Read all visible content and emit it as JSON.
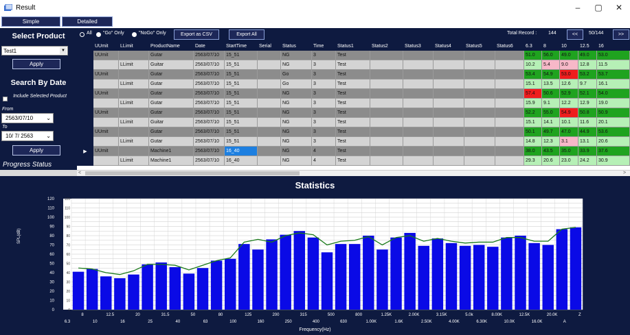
{
  "window": {
    "title": "Result",
    "controls": [
      "–",
      "▢",
      "✕"
    ]
  },
  "tabs": [
    "Simple",
    "Detailed"
  ],
  "sidebar": {
    "select_product_heading": "Select Product",
    "product_value": "Test1",
    "apply_label": "Apply",
    "search_heading": "Search By Date",
    "include_selected_label": "Include Selected Product",
    "from_label": "From",
    "from_value": "2563/07/10",
    "to_label": "To",
    "to_value": "10/ 7/ 2563",
    "apply2_label": "Apply",
    "progress_label": "Progress Status"
  },
  "toolbar": {
    "filter_options": [
      "All",
      "\"Go\" Only",
      "\"NoGo\" Only"
    ],
    "export_csv_label": "Export as CSV",
    "export_all_label": "Export All",
    "total_record_label": "Total Record :",
    "total_record_value": "144",
    "prev_label": "<<",
    "page_label": "50/144",
    "next_label": ">>"
  },
  "table": {
    "columns": [
      "UUmit",
      "LLimit",
      "ProductName",
      "Date",
      "StartTime",
      "Serial",
      "Status",
      "Time",
      "Status1",
      "Status2",
      "Status3",
      "Status4",
      "Status5",
      "Status6",
      "6.3",
      "8",
      "10",
      "12.5",
      "16"
    ],
    "rows": [
      {
        "type": "U",
        "u": "UUmit",
        "l": "",
        "name": "Gutar",
        "date": "2563/07/10",
        "start": "15_51",
        "status": "NG",
        "time": "3",
        "s1": "Test",
        "freq": [
          {
            "v": "51.0",
            "c": "green"
          },
          {
            "v": "56.0",
            "c": "green"
          },
          {
            "v": "49.0",
            "c": "green"
          },
          {
            "v": "49.0",
            "c": "green"
          },
          {
            "v": "53.0",
            "c": "green"
          }
        ]
      },
      {
        "type": "L",
        "u": "",
        "l": "LLimit",
        "name": "Guitar",
        "date": "2563/07/10",
        "start": "15_51",
        "status": "NG",
        "time": "3",
        "s1": "Test",
        "freq": [
          {
            "v": "10.2",
            "c": "lgreen"
          },
          {
            "v": "5.4",
            "c": "pink"
          },
          {
            "v": "9.0",
            "c": "pink"
          },
          {
            "v": "12.8",
            "c": "lgreen"
          },
          {
            "v": "11.5",
            "c": "lgreen"
          }
        ]
      },
      {
        "type": "U",
        "u": "UUmit",
        "l": "",
        "name": "Gutar",
        "date": "2563/07/10",
        "start": "15_51",
        "status": "Go",
        "time": "3",
        "s1": "Test",
        "freq": [
          {
            "v": "53.4",
            "c": "green"
          },
          {
            "v": "54.9",
            "c": "green"
          },
          {
            "v": "53.0",
            "c": "red"
          },
          {
            "v": "53.2",
            "c": "green"
          },
          {
            "v": "53.7",
            "c": "green"
          }
        ]
      },
      {
        "type": "L",
        "u": "",
        "l": "LLimit",
        "name": "Gutar",
        "date": "2563/07/10",
        "start": "15_51",
        "status": "Go",
        "time": "3",
        "s1": "Test",
        "freq": [
          {
            "v": "15.1",
            "c": "lgreen"
          },
          {
            "v": "13.5",
            "c": "lgreen"
          },
          {
            "v": "12.6",
            "c": "lgreen"
          },
          {
            "v": "9.7",
            "c": "lgreen"
          },
          {
            "v": "16.1",
            "c": "lgreen"
          }
        ]
      },
      {
        "type": "U",
        "u": "UUmit",
        "l": "",
        "name": "Gutar",
        "date": "2563/07/10",
        "start": "15_51",
        "status": "NG",
        "time": "3",
        "s1": "Test",
        "freq": [
          {
            "v": "57.4",
            "c": "red"
          },
          {
            "v": "50.6",
            "c": "green"
          },
          {
            "v": "52.9",
            "c": "green"
          },
          {
            "v": "52.1",
            "c": "green"
          },
          {
            "v": "54.0",
            "c": "green"
          }
        ]
      },
      {
        "type": "L",
        "u": "",
        "l": "LLimit",
        "name": "Gutar",
        "date": "2563/07/10",
        "start": "15_51",
        "status": "NG",
        "time": "3",
        "s1": "Test",
        "freq": [
          {
            "v": "15.9",
            "c": "lgreen"
          },
          {
            "v": "9.1",
            "c": "lgreen"
          },
          {
            "v": "12.2",
            "c": "lgreen"
          },
          {
            "v": "12.9",
            "c": "lgreen"
          },
          {
            "v": "19.0",
            "c": "lgreen"
          }
        ]
      },
      {
        "type": "U",
        "u": "UUmit",
        "l": "",
        "name": "Gutar",
        "date": "2563/07/10",
        "start": "15_51",
        "status": "NG",
        "time": "3",
        "s1": "Test",
        "freq": [
          {
            "v": "52.2",
            "c": "green"
          },
          {
            "v": "55.0",
            "c": "green"
          },
          {
            "v": "54.9",
            "c": "red"
          },
          {
            "v": "50.8",
            "c": "green"
          },
          {
            "v": "50.9",
            "c": "green"
          }
        ]
      },
      {
        "type": "L",
        "u": "",
        "l": "LLimit",
        "name": "Guitar",
        "date": "2563/07/10",
        "start": "15_51",
        "status": "NG",
        "time": "3",
        "s1": "Test",
        "freq": [
          {
            "v": "15.1",
            "c": "lgreen"
          },
          {
            "v": "14.1",
            "c": "lgreen"
          },
          {
            "v": "10.1",
            "c": "lgreen"
          },
          {
            "v": "11.6",
            "c": "lgreen"
          },
          {
            "v": "20.1",
            "c": "lgreen"
          }
        ]
      },
      {
        "type": "U",
        "u": "UUmit",
        "l": "",
        "name": "Gutar",
        "date": "2563/07/10",
        "start": "15_51",
        "status": "NG",
        "time": "3",
        "s1": "Test",
        "freq": [
          {
            "v": "50.1",
            "c": "green"
          },
          {
            "v": "49.7",
            "c": "green"
          },
          {
            "v": "47.0",
            "c": "green"
          },
          {
            "v": "44.9",
            "c": "green"
          },
          {
            "v": "53.6",
            "c": "green"
          }
        ]
      },
      {
        "type": "L",
        "u": "",
        "l": "LLimit",
        "name": "Gutar",
        "date": "2563/07/10",
        "start": "15_51",
        "status": "NG",
        "time": "3",
        "s1": "Test",
        "freq": [
          {
            "v": "14.8",
            "c": "lgreen"
          },
          {
            "v": "12.3",
            "c": "lgreen"
          },
          {
            "v": "3.1",
            "c": "pink"
          },
          {
            "v": "13.1",
            "c": "lgreen"
          },
          {
            "v": "20.6",
            "c": "lgreen"
          }
        ]
      },
      {
        "type": "U",
        "u": "UUmit",
        "l": "",
        "name": "Machine1",
        "date": "2563/07/10",
        "start": "16_40",
        "status": "NG",
        "time": "4",
        "s1": "Test",
        "selected": true,
        "freq": [
          {
            "v": "38.0",
            "c": "green"
          },
          {
            "v": "43.5",
            "c": "green"
          },
          {
            "v": "35.0",
            "c": "green"
          },
          {
            "v": "33.9",
            "c": "green"
          },
          {
            "v": "37.6",
            "c": "green"
          }
        ]
      },
      {
        "type": "L",
        "u": "",
        "l": "LLimit",
        "name": "Machine1",
        "date": "2563/07/10",
        "start": "16_40",
        "status": "NG",
        "time": "4",
        "s1": "Test",
        "freq": [
          {
            "v": "29.3",
            "c": "lgreen"
          },
          {
            "v": "20.6",
            "c": "lgreen"
          },
          {
            "v": "23.0",
            "c": "lgreen"
          },
          {
            "v": "24.2",
            "c": "lgreen"
          },
          {
            "v": "30.9",
            "c": "lgreen"
          }
        ]
      }
    ]
  },
  "colors": {
    "navy": "#0e1a40",
    "button": "#1d2758",
    "bar": "#0a0ae6",
    "line": "#1a7a1a",
    "green": "#1fa31f",
    "lgreen": "#b6f0b6",
    "red": "#ee1d1d",
    "pink": "#f7b8c8",
    "upper_row": "#8c8c8c",
    "lower_row": "#d4d4d4",
    "selected": "#1d7fe0"
  },
  "chart_data": {
    "type": "bar",
    "title": "Statistics",
    "xlabel": "Frequency(Hz)",
    "ylabel": "SPL(dB)",
    "ylim": [
      0,
      120
    ],
    "y_ticks": [
      0,
      5,
      10,
      15,
      20,
      25,
      30,
      35,
      40,
      45,
      50,
      55,
      60,
      65,
      70,
      75,
      80,
      85,
      90,
      95,
      100,
      105,
      110,
      115,
      120
    ],
    "y_tick_labels": [
      "0",
      "10",
      "20",
      "30",
      "40",
      "50",
      "60",
      "70",
      "80",
      "90",
      "100",
      "110",
      "120"
    ],
    "grid": true,
    "categories": [
      "6.3",
      "8",
      "10",
      "12.5",
      "16",
      "20",
      "25",
      "31.5",
      "40",
      "50",
      "63",
      "80",
      "100",
      "125",
      "160",
      "200",
      "250",
      "315",
      "400",
      "500",
      "630",
      "800",
      "1.00K",
      "1.25K",
      "1.6K",
      "2.00K",
      "2.50K",
      "3.15K",
      "4.00K",
      "5.0k",
      "6.30K",
      "8.00K",
      "10.0K",
      "12.5K",
      "16.0K",
      "20.0K",
      "A",
      "Z"
    ],
    "label_rows": {
      "upper": [
        "8",
        "12.5",
        "20",
        "31.5",
        "50",
        "80",
        "125",
        "200",
        "315",
        "500",
        "800",
        "1.25K",
        "2.00K",
        "3.15K",
        "5.0k",
        "8.00K",
        "12.5K",
        "20.0K",
        "Z"
      ],
      "lower": [
        "6.3",
        "10",
        "16",
        "25",
        "40",
        "63",
        "100",
        "160",
        "250",
        "400",
        "630",
        "1.00K",
        "1.6K",
        "2.50K",
        "4.00K",
        "6.30K",
        "10.0K",
        "16.0K",
        "A"
      ]
    },
    "series": [
      {
        "values": [
          41,
          44,
          36,
          34,
          38,
          49,
          51,
          46,
          39,
          45,
          53,
          55,
          71,
          65,
          76,
          81,
          85,
          78,
          62,
          71,
          71,
          80,
          65,
          78,
          83,
          69,
          77,
          72,
          69,
          70,
          68,
          78,
          80,
          72,
          70,
          87,
          89
        ]
      },
      {
        "type": "line",
        "values": [
          45,
          44,
          40,
          38,
          42,
          49,
          49,
          48,
          43,
          48,
          53,
          56,
          73,
          76,
          73,
          80,
          83,
          81,
          70,
          74,
          75,
          79,
          70,
          78,
          80,
          74,
          77,
          74,
          72,
          73,
          73,
          78,
          78,
          74,
          74,
          87,
          89
        ]
      }
    ]
  }
}
